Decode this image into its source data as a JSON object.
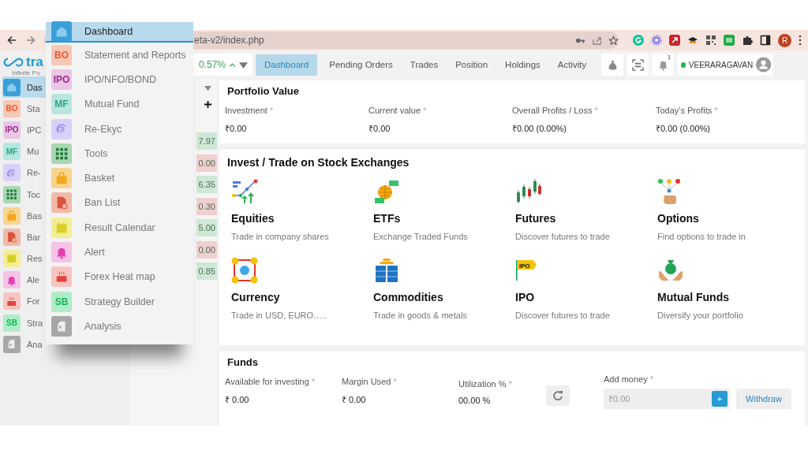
{
  "browser": {
    "url": "eta-v2/index.php",
    "profile_initial": "R"
  },
  "sidebar": {
    "logo_text": "tra",
    "tagline": "Infinite Po",
    "items": [
      {
        "label": "Das",
        "selected": true
      },
      {
        "label": "Sta",
        "badge": "BO",
        "selected": false
      },
      {
        "label": "IPC",
        "badge": "IPO",
        "selected": false
      },
      {
        "label": "Mu",
        "badge": "MF",
        "selected": false
      },
      {
        "label": "Re-",
        "selected": false
      },
      {
        "label": "Toc",
        "selected": false
      },
      {
        "label": "Bas",
        "selected": false
      },
      {
        "label": "Bar",
        "selected": false
      },
      {
        "label": "Res",
        "selected": false
      },
      {
        "label": "Ale",
        "selected": false
      },
      {
        "label": "For",
        "selected": false
      },
      {
        "label": "Stra",
        "badge": "SB",
        "selected": false
      },
      {
        "label": "Ana",
        "selected": false
      }
    ]
  },
  "menu": {
    "items": [
      {
        "label": "Dashboard",
        "selected": true
      },
      {
        "label": "Statement and Reports",
        "badge": "BO",
        "selected": false
      },
      {
        "label": "IPO/NFO/BOND",
        "badge": "IPO",
        "selected": false
      },
      {
        "label": "Mutual Fund",
        "badge": "MF",
        "selected": false
      },
      {
        "label": "Re-Ekyc",
        "selected": false
      },
      {
        "label": "Tools",
        "selected": false
      },
      {
        "label": "Basket",
        "selected": false
      },
      {
        "label": "Ban List",
        "selected": false
      },
      {
        "label": "Result Calendar",
        "selected": false
      },
      {
        "label": "Alert",
        "selected": false
      },
      {
        "label": "Forex Heat map",
        "selected": false
      },
      {
        "label": "Strategy Builder",
        "badge": "SB",
        "selected": false
      },
      {
        "label": "Analysis",
        "selected": false
      }
    ]
  },
  "ticker": {
    "change": "0.57%"
  },
  "watchlist": {
    "rows": [
      {
        "value": "7.97",
        "color": "#cfe8d6"
      },
      {
        "value": "0.00",
        "color": "#efcfcf"
      },
      {
        "value": "6.35",
        "color": "#cfe8d6"
      },
      {
        "value": "0.30",
        "color": "#efcfcf"
      },
      {
        "value": "5.00",
        "color": "#cfe8d6"
      },
      {
        "value": "0.00",
        "color": "#efcfcf"
      },
      {
        "value": "0.85",
        "color": "#cfe8d6"
      }
    ]
  },
  "tabs": [
    {
      "label": "Dashboard",
      "selected": true
    },
    {
      "label": "Pending Orders",
      "selected": false
    },
    {
      "label": "Trades",
      "selected": false
    },
    {
      "label": "Position",
      "selected": false
    },
    {
      "label": "Holdings",
      "selected": false
    },
    {
      "label": "Activity",
      "selected": false
    }
  ],
  "notifications": {
    "count": "1"
  },
  "user": {
    "name": "VEERARAGAVAN",
    "online": true
  },
  "portfolio": {
    "title": "Portfolio Value",
    "fields": [
      {
        "label": "Investment",
        "mark": "*",
        "value": "₹0.00"
      },
      {
        "label": "Current value",
        "mark": "*",
        "value": "₹0.00"
      },
      {
        "label": "Overall Profits / Loss",
        "mark": "*",
        "value": "₹0.00 (0.00%)"
      },
      {
        "label": "Today's Profits",
        "mark": "*",
        "value": "₹0.00 (0.00%)"
      }
    ]
  },
  "invest": {
    "title": "Invest / Trade on Stock Exchanges",
    "items": [
      {
        "title": "Equities",
        "subtitle": "Trade in company shares"
      },
      {
        "title": "ETFs",
        "subtitle": "Exchange Traded Funds"
      },
      {
        "title": "Futures",
        "subtitle": "Discover futures to trade"
      },
      {
        "title": "Options",
        "subtitle": "Find options to trade in"
      },
      {
        "title": "Currency",
        "subtitle": "Trade in USD, EURO….."
      },
      {
        "title": "Commodities",
        "subtitle": "Trade in goods & metals"
      },
      {
        "title": "IPO",
        "subtitle": "Discover futures to trade",
        "icon_text": "IPO"
      },
      {
        "title": "Mutual Funds",
        "subtitle": "Diversify your portfolio"
      }
    ]
  },
  "funds": {
    "title": "Funds",
    "fields": [
      {
        "label": "Available for investing",
        "mark": "*",
        "value": "₹ 0.00"
      },
      {
        "label": "Margin Used",
        "mark": "*",
        "value": "₹ 0.00"
      },
      {
        "label": "Utilization %",
        "mark": "*",
        "value": "00.00 %"
      }
    ],
    "add_money": {
      "label": "Add money",
      "mark": "*",
      "placeholder": "₹0.00",
      "add_button": "+"
    },
    "withdraw_button": "Withdraw"
  }
}
